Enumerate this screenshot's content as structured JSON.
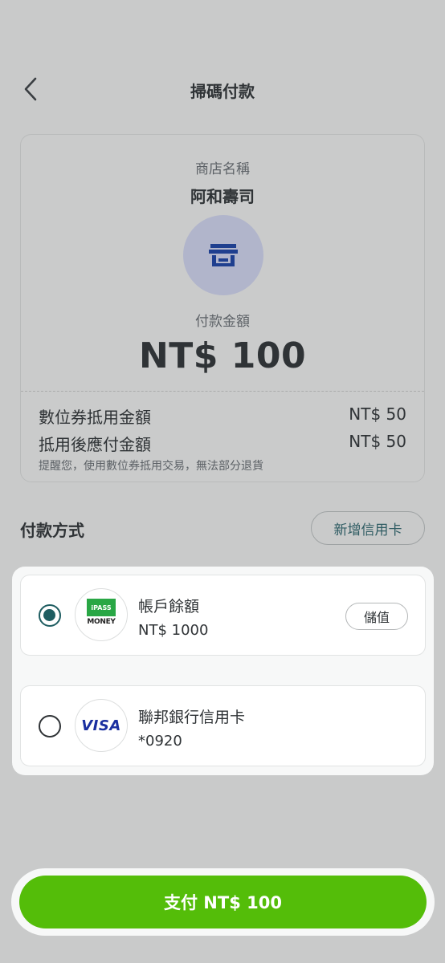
{
  "header": {
    "title": "掃碼付款",
    "back_icon": "chevron-left-icon"
  },
  "store": {
    "label": "商店名稱",
    "name": "阿和壽司",
    "icon": "store-icon",
    "amount_label": "付款金額",
    "amount": "NT$ 100",
    "voucher_label": "數位券抵用金額",
    "voucher_value": "NT$ 50",
    "payable_label": "抵用後應付金額",
    "payable_value": "NT$ 50",
    "note": "提醒您，使用數位券抵用交易，無法部分退貨"
  },
  "payment": {
    "section_title": "付款方式",
    "add_card_label": "新增信用卡",
    "methods": [
      {
        "name": "帳戶餘額",
        "detail": "NT$ 1000",
        "logo_top": "iPASS",
        "logo_bottom": "MONEY",
        "action": "儲值",
        "selected": true
      },
      {
        "name": "聯邦銀行信用卡",
        "detail": "*0920",
        "logo": "VISA",
        "selected": false
      }
    ]
  },
  "pay_button": {
    "label": "支付 NT$ 100"
  },
  "colors": {
    "background": "#c9caca",
    "accent_green": "#54bd09",
    "radio_teal": "#1e5d61"
  }
}
